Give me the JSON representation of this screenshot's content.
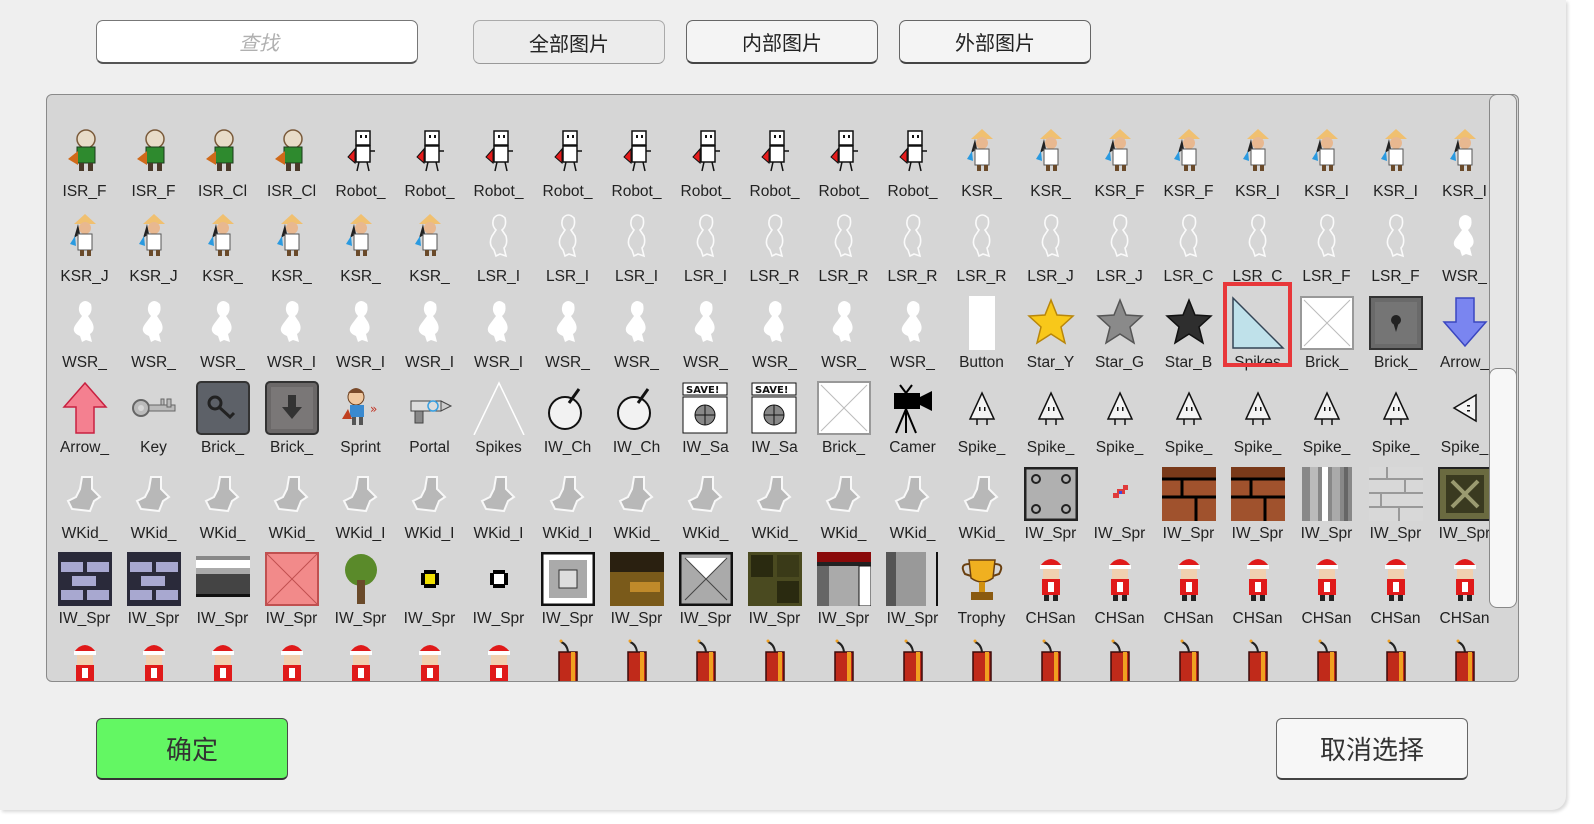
{
  "search": {
    "placeholder": "查找",
    "value": ""
  },
  "filter_tabs": [
    {
      "label": "全部图片",
      "active": true
    },
    {
      "label": "内部图片",
      "active": false
    },
    {
      "label": "外部图片",
      "active": false
    }
  ],
  "grid": {
    "selected_index": 80,
    "items": [
      {
        "label": "",
        "icon": "partial"
      },
      {
        "label": "",
        "icon": "partial"
      },
      {
        "label": "",
        "icon": "partial"
      },
      {
        "label": "",
        "icon": "partial"
      },
      {
        "label": "",
        "icon": "partial"
      },
      {
        "label": "",
        "icon": "partial"
      },
      {
        "label": "",
        "icon": "partial"
      },
      {
        "label": "",
        "icon": "partial"
      },
      {
        "label": "",
        "icon": "partial"
      },
      {
        "label": "",
        "icon": "partial"
      },
      {
        "label": "",
        "icon": "partial"
      },
      {
        "label": "",
        "icon": "partial"
      },
      {
        "label": "",
        "icon": "partial"
      },
      {
        "label": "",
        "icon": "partial"
      },
      {
        "label": "",
        "icon": "partial"
      },
      {
        "label": "",
        "icon": "partial"
      },
      {
        "label": "",
        "icon": "partial"
      },
      {
        "label": "",
        "icon": "partial"
      },
      {
        "label": "",
        "icon": "partial"
      },
      {
        "label": "",
        "icon": "partial"
      },
      {
        "label": "",
        "icon": "partial"
      },
      {
        "label": "ISR_F",
        "icon": "isr-character"
      },
      {
        "label": "ISR_F",
        "icon": "isr-character"
      },
      {
        "label": "ISR_Cl",
        "icon": "isr-character"
      },
      {
        "label": "ISR_Cl",
        "icon": "isr-character"
      },
      {
        "label": "Robot_",
        "icon": "robot"
      },
      {
        "label": "Robot_",
        "icon": "robot"
      },
      {
        "label": "Robot_",
        "icon": "robot"
      },
      {
        "label": "Robot_",
        "icon": "robot"
      },
      {
        "label": "Robot_",
        "icon": "robot"
      },
      {
        "label": "Robot_",
        "icon": "robot"
      },
      {
        "label": "Robot_",
        "icon": "robot"
      },
      {
        "label": "Robot_",
        "icon": "robot"
      },
      {
        "label": "Robot_",
        "icon": "robot"
      },
      {
        "label": "KSR_",
        "icon": "ksr-character"
      },
      {
        "label": "KSR_",
        "icon": "ksr-character"
      },
      {
        "label": "KSR_F",
        "icon": "ksr-character"
      },
      {
        "label": "KSR_F",
        "icon": "ksr-character"
      },
      {
        "label": "KSR_I",
        "icon": "ksr-character"
      },
      {
        "label": "KSR_I",
        "icon": "ksr-character"
      },
      {
        "label": "KSR_I",
        "icon": "ksr-character"
      },
      {
        "label": "KSR_I",
        "icon": "ksr-character"
      },
      {
        "label": "KSR_J",
        "icon": "ksr-character"
      },
      {
        "label": "KSR_J",
        "icon": "ksr-character"
      },
      {
        "label": "KSR_",
        "icon": "ksr-character"
      },
      {
        "label": "KSR_",
        "icon": "ksr-character"
      },
      {
        "label": "KSR_",
        "icon": "ksr-character"
      },
      {
        "label": "KSR_",
        "icon": "ksr-character"
      },
      {
        "label": "LSR_I",
        "icon": "outline-silhouette"
      },
      {
        "label": "LSR_I",
        "icon": "outline-silhouette"
      },
      {
        "label": "LSR_I",
        "icon": "outline-silhouette"
      },
      {
        "label": "LSR_I",
        "icon": "outline-silhouette"
      },
      {
        "label": "LSR_R",
        "icon": "outline-silhouette"
      },
      {
        "label": "LSR_R",
        "icon": "outline-silhouette"
      },
      {
        "label": "LSR_R",
        "icon": "outline-silhouette"
      },
      {
        "label": "LSR_R",
        "icon": "outline-silhouette"
      },
      {
        "label": "LSR_J",
        "icon": "outline-silhouette"
      },
      {
        "label": "LSR_J",
        "icon": "outline-silhouette"
      },
      {
        "label": "LSR_C",
        "icon": "outline-silhouette"
      },
      {
        "label": "LSR_C",
        "icon": "outline-silhouette"
      },
      {
        "label": "LSR_F",
        "icon": "outline-silhouette"
      },
      {
        "label": "LSR_F",
        "icon": "outline-silhouette"
      },
      {
        "label": "WSR_",
        "icon": "white-silhouette"
      },
      {
        "label": "WSR_",
        "icon": "white-silhouette"
      },
      {
        "label": "WSR_",
        "icon": "white-silhouette"
      },
      {
        "label": "WSR_",
        "icon": "white-silhouette"
      },
      {
        "label": "WSR_I",
        "icon": "white-silhouette"
      },
      {
        "label": "WSR_I",
        "icon": "white-silhouette"
      },
      {
        "label": "WSR_I",
        "icon": "white-silhouette"
      },
      {
        "label": "WSR_I",
        "icon": "white-silhouette"
      },
      {
        "label": "WSR_",
        "icon": "white-silhouette"
      },
      {
        "label": "WSR_",
        "icon": "white-silhouette"
      },
      {
        "label": "WSR_",
        "icon": "white-silhouette"
      },
      {
        "label": "WSR_",
        "icon": "white-silhouette"
      },
      {
        "label": "WSR_",
        "icon": "white-silhouette"
      },
      {
        "label": "WSR_",
        "icon": "white-silhouette"
      },
      {
        "label": "Button",
        "icon": "white-bar"
      },
      {
        "label": "Star_Y",
        "icon": "star-yellow"
      },
      {
        "label": "Star_G",
        "icon": "star-gray"
      },
      {
        "label": "Star_B",
        "icon": "star-black"
      },
      {
        "label": "Spikes",
        "icon": "triangle-glass"
      },
      {
        "label": "Brick_",
        "icon": "brick-white-x"
      },
      {
        "label": "Brick_",
        "icon": "brick-keyhole"
      },
      {
        "label": "Arrow_",
        "icon": "arrow-down-blue"
      },
      {
        "label": "Arrow_",
        "icon": "arrow-up-red"
      },
      {
        "label": "Key",
        "icon": "key"
      },
      {
        "label": "Brick_",
        "icon": "brick-key"
      },
      {
        "label": "Brick_",
        "icon": "brick-down"
      },
      {
        "label": "Sprint",
        "icon": "sprint-character"
      },
      {
        "label": "Portal",
        "icon": "portal-gun"
      },
      {
        "label": "Spikes",
        "icon": "spikes-outline"
      },
      {
        "label": "IW_Ch",
        "icon": "cherry"
      },
      {
        "label": "IW_Ch",
        "icon": "cherry"
      },
      {
        "label": "IW_Sa",
        "icon": "save-point"
      },
      {
        "label": "IW_Sa",
        "icon": "save-point"
      },
      {
        "label": "Brick_",
        "icon": "brick-white-x"
      },
      {
        "label": "Camer",
        "icon": "camera"
      },
      {
        "label": "Spike_",
        "icon": "spike-up"
      },
      {
        "label": "Spike_",
        "icon": "spike-up"
      },
      {
        "label": "Spike_",
        "icon": "spike-up"
      },
      {
        "label": "Spike_",
        "icon": "spike-up"
      },
      {
        "label": "Spike_",
        "icon": "spike-up"
      },
      {
        "label": "Spike_",
        "icon": "spike-up"
      },
      {
        "label": "Spike_",
        "icon": "spike-up"
      },
      {
        "label": "Spike_",
        "icon": "spike-left"
      },
      {
        "label": "WKid_",
        "icon": "gray-kid"
      },
      {
        "label": "WKid_",
        "icon": "gray-kid"
      },
      {
        "label": "WKid_",
        "icon": "gray-kid"
      },
      {
        "label": "WKid_",
        "icon": "gray-kid"
      },
      {
        "label": "WKid_I",
        "icon": "gray-kid"
      },
      {
        "label": "WKid_I",
        "icon": "gray-kid"
      },
      {
        "label": "WKid_I",
        "icon": "gray-kid"
      },
      {
        "label": "WKid_I",
        "icon": "gray-kid"
      },
      {
        "label": "WKid_",
        "icon": "gray-kid"
      },
      {
        "label": "WKid_",
        "icon": "gray-kid"
      },
      {
        "label": "WKid_",
        "icon": "gray-kid"
      },
      {
        "label": "WKid_",
        "icon": "gray-kid"
      },
      {
        "label": "WKid_",
        "icon": "gray-kid"
      },
      {
        "label": "WKid_",
        "icon": "gray-kid"
      },
      {
        "label": "IW_Spr",
        "icon": "metal-plate"
      },
      {
        "label": "IW_Spr",
        "icon": "red-bow"
      },
      {
        "label": "IW_Spr",
        "icon": "brown-brick"
      },
      {
        "label": "IW_Spr",
        "icon": "brown-brick"
      },
      {
        "label": "IW_Spr",
        "icon": "gray-pillar"
      },
      {
        "label": "IW_Spr",
        "icon": "stone-wall"
      },
      {
        "label": "IW_Spr",
        "icon": "olive-block"
      },
      {
        "label": "IW_Spr",
        "icon": "purple-brick"
      },
      {
        "label": "IW_Spr",
        "icon": "purple-brick"
      },
      {
        "label": "IW_Spr",
        "icon": "gray-stripes"
      },
      {
        "label": "IW_Spr",
        "icon": "pink-x-block"
      },
      {
        "label": "IW_Spr",
        "icon": "tree"
      },
      {
        "label": "IW_Spr",
        "icon": "yellow-dot"
      },
      {
        "label": "IW_Spr",
        "icon": "white-dot"
      },
      {
        "label": "IW_Spr",
        "icon": "framed-block"
      },
      {
        "label": "IW_Spr",
        "icon": "dark-gold-block"
      },
      {
        "label": "IW_Spr",
        "icon": "metal-x-block"
      },
      {
        "label": "IW_Spr",
        "icon": "olive-brick"
      },
      {
        "label": "IW_Spr",
        "icon": "red-top-pillar"
      },
      {
        "label": "IW_Spr",
        "icon": "gray-pillar-2"
      },
      {
        "label": "Trophy",
        "icon": "trophy"
      },
      {
        "label": "CHSan",
        "icon": "santa-character"
      },
      {
        "label": "CHSan",
        "icon": "santa-character"
      },
      {
        "label": "CHSan",
        "icon": "santa-character"
      },
      {
        "label": "CHSan",
        "icon": "santa-character"
      },
      {
        "label": "CHSan",
        "icon": "santa-character"
      },
      {
        "label": "CHSan",
        "icon": "santa-character"
      },
      {
        "label": "CHSan",
        "icon": "santa-character"
      },
      {
        "label": "",
        "icon": "santa-character"
      },
      {
        "label": "",
        "icon": "santa-character"
      },
      {
        "label": "",
        "icon": "santa-character"
      },
      {
        "label": "",
        "icon": "santa-character"
      },
      {
        "label": "",
        "icon": "santa-character"
      },
      {
        "label": "",
        "icon": "santa-character"
      },
      {
        "label": "",
        "icon": "santa-character"
      },
      {
        "label": "",
        "icon": "firecracker"
      },
      {
        "label": "",
        "icon": "firecracker"
      },
      {
        "label": "",
        "icon": "firecracker"
      },
      {
        "label": "",
        "icon": "firecracker"
      },
      {
        "label": "",
        "icon": "firecracker"
      },
      {
        "label": "",
        "icon": "firecracker"
      },
      {
        "label": "",
        "icon": "firecracker"
      },
      {
        "label": "",
        "icon": "firecracker"
      },
      {
        "label": "",
        "icon": "firecracker"
      },
      {
        "label": "",
        "icon": "firecracker"
      },
      {
        "label": "",
        "icon": "firecracker"
      },
      {
        "label": "",
        "icon": "firecracker"
      },
      {
        "label": "",
        "icon": "firecracker"
      },
      {
        "label": "",
        "icon": "firecracker"
      }
    ]
  },
  "scrollbar": {
    "position_fraction": 0.55
  },
  "footer": {
    "confirm_label": "确定",
    "cancel_label": "取消选择"
  },
  "colors": {
    "confirm_bg": "#63f763",
    "selection_outline": "#e8373a",
    "grid_bg": "#d6d6d6",
    "panel_bg": "#efefef"
  }
}
